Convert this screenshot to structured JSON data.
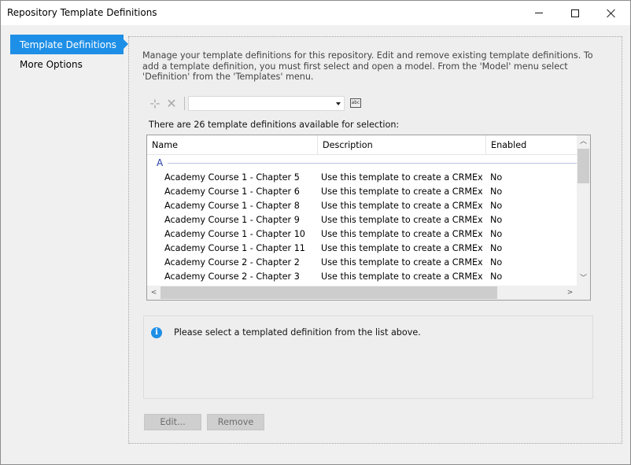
{
  "window": {
    "title": "Repository Template Definitions"
  },
  "sidebar": {
    "items": [
      {
        "label": "Template Definitions",
        "active": true
      },
      {
        "label": "More Options",
        "active": false
      }
    ]
  },
  "main": {
    "intro": "Manage your template definitions for this repository. Edit and remove existing template definitions. To add a template definition, you must first select and open a model. From the 'Model' menu select 'Definition' from the 'Templates' menu.",
    "toolbar": {
      "add_icon": "add-template-icon",
      "delete_icon": "delete-icon",
      "filter_value": "",
      "abc_icon": "spell-check-icon",
      "abc_text": "abc"
    },
    "count_label": "There are 26 template definitions available for selection:",
    "list": {
      "columns": [
        "Name",
        "Description",
        "Enabled"
      ],
      "group": "A",
      "rows": [
        {
          "name": "Academy Course 1 - Chapter 5",
          "description": "Use this template to create a CRMExer...",
          "enabled": "No"
        },
        {
          "name": "Academy Course 1 - Chapter 6",
          "description": "Use this template to create a CRMExer...",
          "enabled": "No"
        },
        {
          "name": "Academy Course 1 - Chapter 8",
          "description": "Use this template to create a CRMExer...",
          "enabled": "No"
        },
        {
          "name": "Academy Course 1 - Chapter 9",
          "description": "Use this template to create a CRMExer...",
          "enabled": "No"
        },
        {
          "name": "Academy Course 1 - Chapter 10",
          "description": "Use this template to create a CRMExer...",
          "enabled": "No"
        },
        {
          "name": "Academy Course 1 - Chapter 11",
          "description": "Use this template to create a CRMExer...",
          "enabled": "No"
        },
        {
          "name": "Academy Course 2 - Chapter 2",
          "description": "Use this template to create a CRMExer...",
          "enabled": "No"
        },
        {
          "name": "Academy Course 2 - Chapter 3",
          "description": "Use this template to create a CRMExer...",
          "enabled": "No"
        }
      ]
    },
    "info_message": "Please select a templated definition from the list above.",
    "buttons": {
      "edit": "Edit...",
      "remove": "Remove"
    }
  },
  "colors": {
    "accent": "#1e8fe6"
  }
}
